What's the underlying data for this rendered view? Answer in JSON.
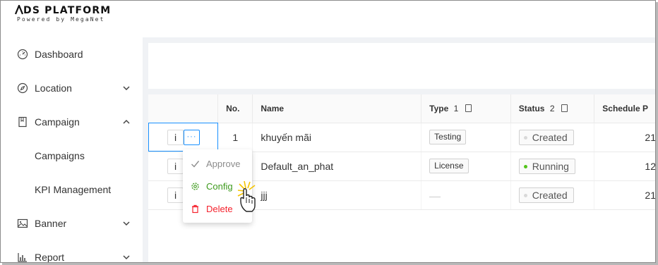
{
  "app": {
    "logo_title": "DS PLATFORM",
    "logo_sub": "Powered by MegaNet"
  },
  "sidebar": {
    "items": [
      {
        "label": "Dashboard",
        "icon": "dashboard-icon"
      },
      {
        "label": "Location",
        "icon": "compass-icon",
        "chevron": "down"
      },
      {
        "label": "Campaign",
        "icon": "book-icon",
        "chevron": "up"
      },
      {
        "label": "Campaigns"
      },
      {
        "label": "KPI Management"
      },
      {
        "label": "Banner",
        "icon": "image-icon",
        "chevron": "down"
      },
      {
        "label": "Report",
        "icon": "bar-chart-icon",
        "chevron": "down"
      }
    ]
  },
  "table": {
    "columns": {
      "no": "No.",
      "name": "Name",
      "type": "Type",
      "type_sort": "1",
      "status": "Status",
      "status_sort": "2",
      "schedule": "Schedule P"
    },
    "action_info": "i",
    "action_more": "···",
    "rows": [
      {
        "no": "1",
        "name": "khuyến mãi",
        "type": "Testing",
        "status": "Created",
        "schedule": "21"
      },
      {
        "no": "",
        "name": "Default_an_phat",
        "type": "License",
        "status": "Running",
        "schedule": "12"
      },
      {
        "no": "",
        "name": "jjj",
        "type": "",
        "status": "Created",
        "schedule": "21"
      }
    ]
  },
  "dropdown": {
    "approve": "Approve",
    "config": "Config",
    "delete": "Delete"
  },
  "colors": {
    "primary": "#1890ff",
    "success": "#52c41a",
    "config": "#52a42a",
    "danger": "#f5222d",
    "disabled": "#8c8c8c"
  }
}
